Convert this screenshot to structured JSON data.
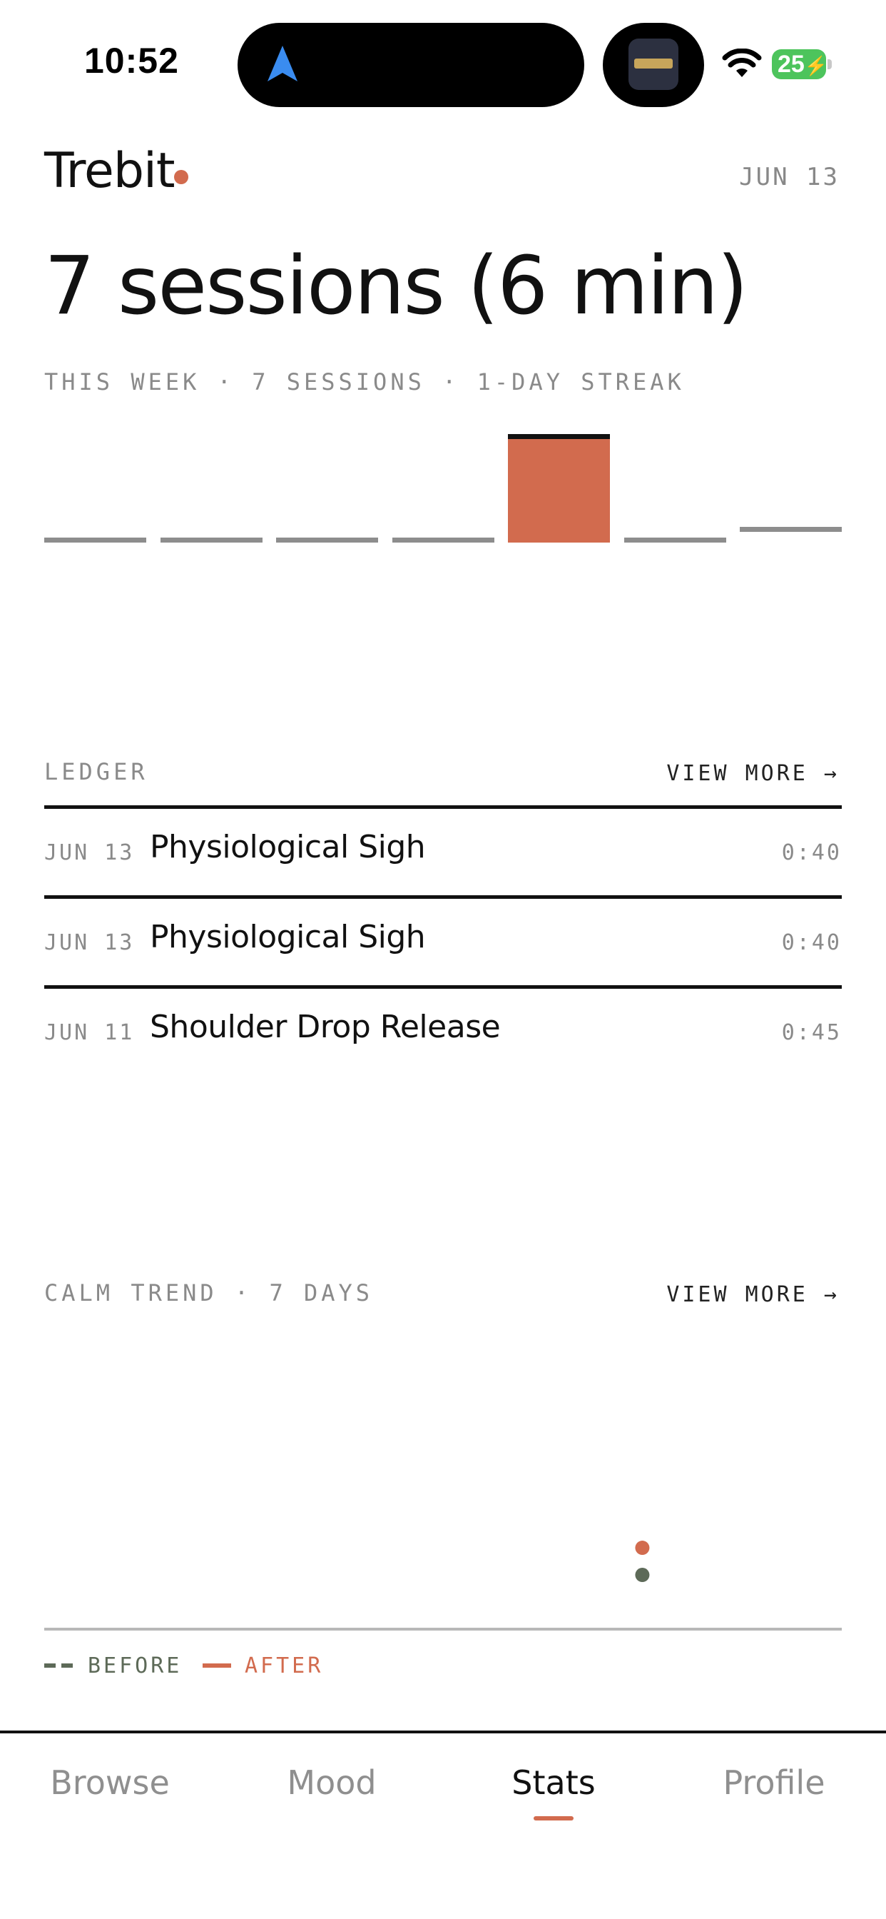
{
  "status_bar": {
    "time": "10:52",
    "battery": "25"
  },
  "header": {
    "app_name": "Trebit",
    "date": "JUN 13",
    "accent_color": "#d26b4e"
  },
  "summary": {
    "headline": "7 sessions (6 min)",
    "week_line": "THIS WEEK · 7 SESSIONS · 1-DAY STREAK"
  },
  "chart_data": [
    {
      "type": "bar",
      "values": [
        0,
        0,
        0,
        0,
        7,
        0,
        1
      ],
      "highlight_index": 4,
      "colors": {
        "active": "#d26b4e",
        "empty": "#8d8d8d",
        "cap": "#111111"
      }
    },
    {
      "type": "scatter",
      "series": [
        {
          "name": "BEFORE",
          "color": "#5d6a58",
          "x": [
            5
          ],
          "y": [
            2
          ]
        },
        {
          "name": "AFTER",
          "color": "#d26b4e",
          "x": [
            5
          ],
          "y": [
            3
          ]
        }
      ],
      "x_count": 7,
      "ylim": [
        0,
        10
      ]
    }
  ],
  "ledger": {
    "label": "LEDGER",
    "view_more": "VIEW MORE →",
    "rows": [
      {
        "date": "JUN 13",
        "name": "Physiological Sigh",
        "duration": "0:40"
      },
      {
        "date": "JUN 13",
        "name": "Physiological Sigh",
        "duration": "0:40"
      },
      {
        "date": "JUN 11",
        "name": "Shoulder Drop Release",
        "duration": "0:45"
      }
    ]
  },
  "calm_trend": {
    "label": "CALM TREND · 7 DAYS",
    "view_more": "VIEW MORE →",
    "legend_before": "BEFORE",
    "legend_after": "AFTER",
    "before_color": "#5d6a58",
    "after_color": "#d26b4e"
  },
  "tabs": [
    {
      "label": "Browse",
      "active": false
    },
    {
      "label": "Mood",
      "active": false
    },
    {
      "label": "Stats",
      "active": true
    },
    {
      "label": "Profile",
      "active": false
    }
  ]
}
